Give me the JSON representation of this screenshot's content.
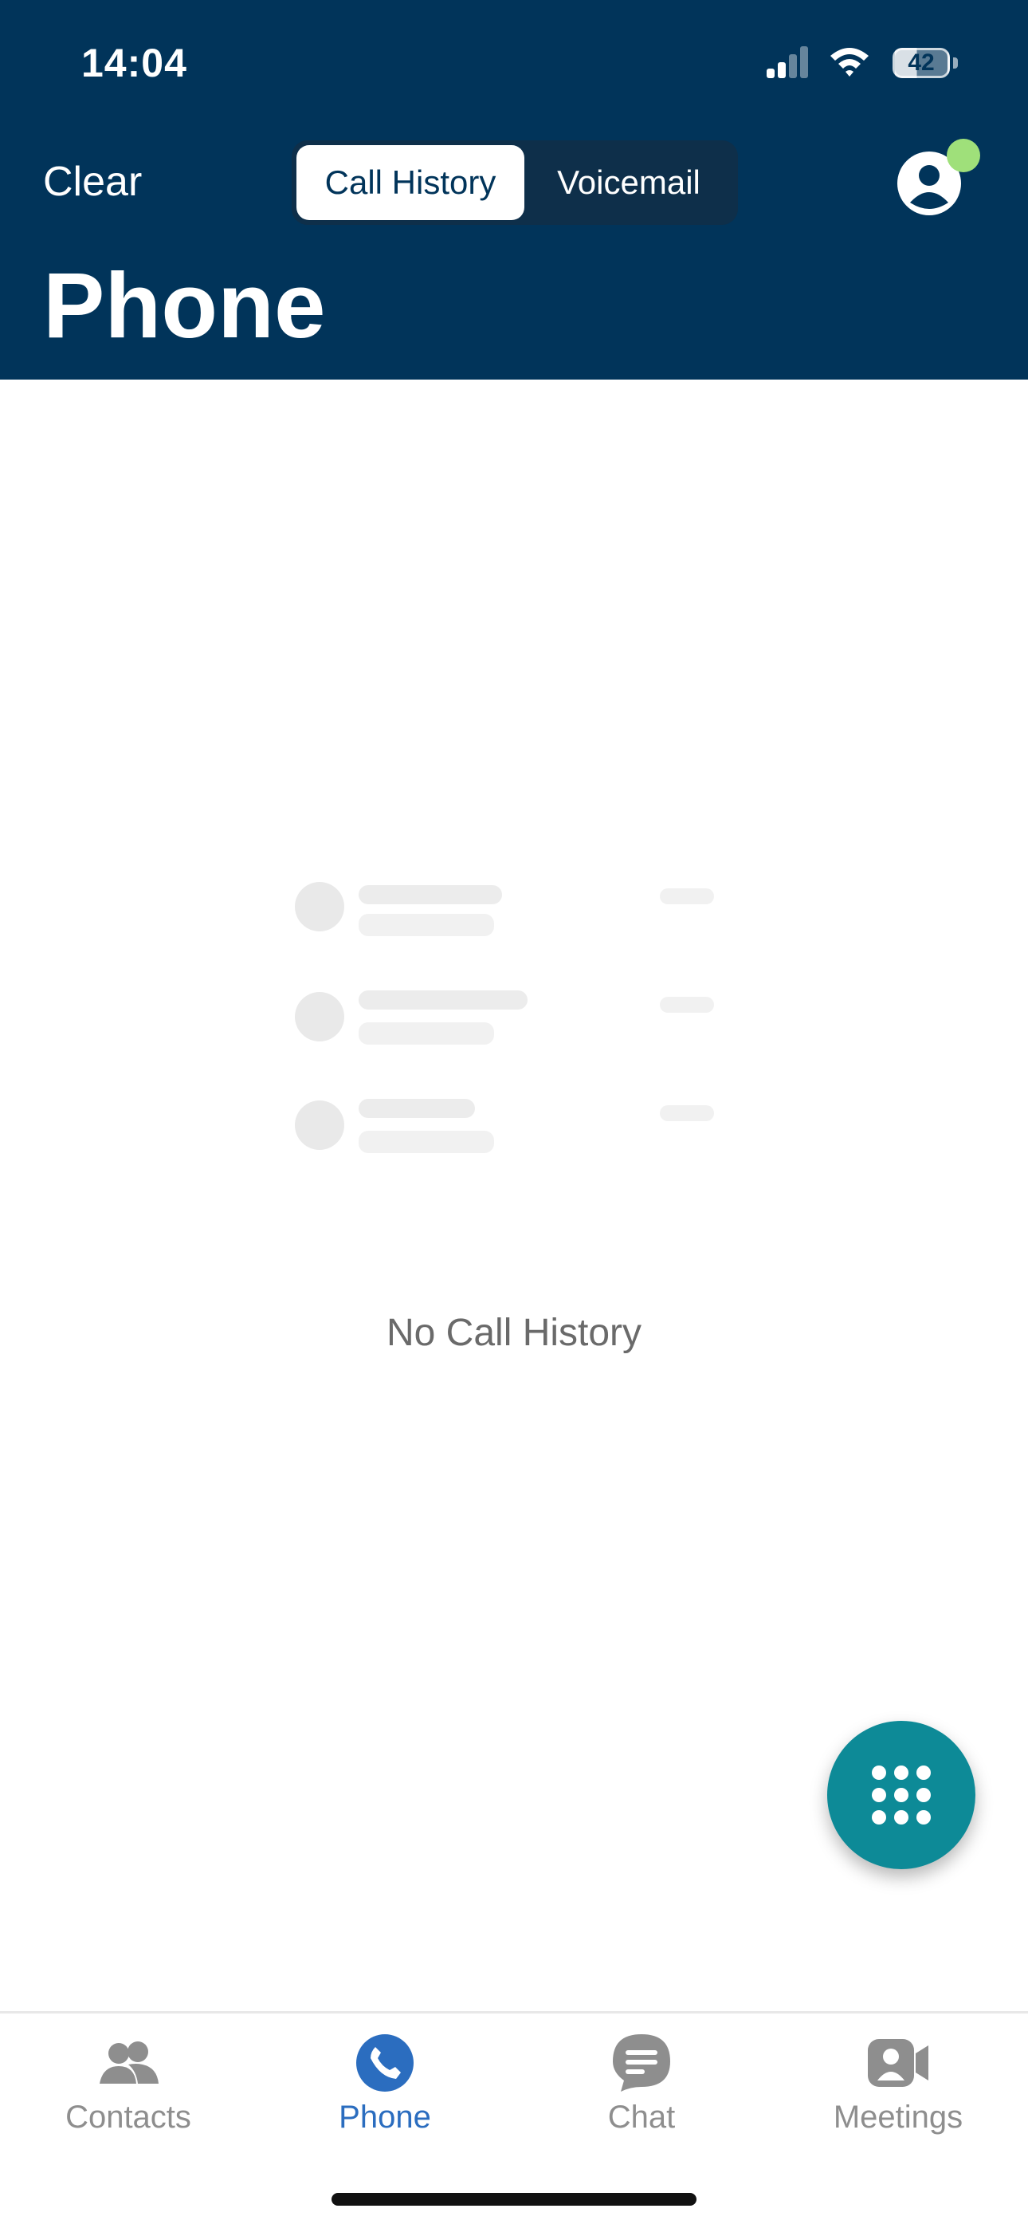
{
  "status_bar": {
    "time": "14:04",
    "battery_level": "42"
  },
  "header": {
    "clear_label": "Clear",
    "segments": {
      "active": "Call History",
      "inactive": "Voicemail"
    },
    "title": "Phone",
    "presence_color": "#9fe07a",
    "background_color": "#01345a"
  },
  "empty_state": {
    "message": "No Call History"
  },
  "fab": {
    "icon": "dialpad-icon",
    "color": "#0d8a97"
  },
  "tabbar": {
    "items": [
      {
        "label": "Contacts",
        "icon": "contacts-icon",
        "active": false
      },
      {
        "label": "Phone",
        "icon": "phone-icon",
        "active": true
      },
      {
        "label": "Chat",
        "icon": "chat-icon",
        "active": false
      },
      {
        "label": "Meetings",
        "icon": "meetings-icon",
        "active": false
      }
    ],
    "active_color": "#2b6dbf",
    "inactive_color": "#8e8e8e"
  }
}
